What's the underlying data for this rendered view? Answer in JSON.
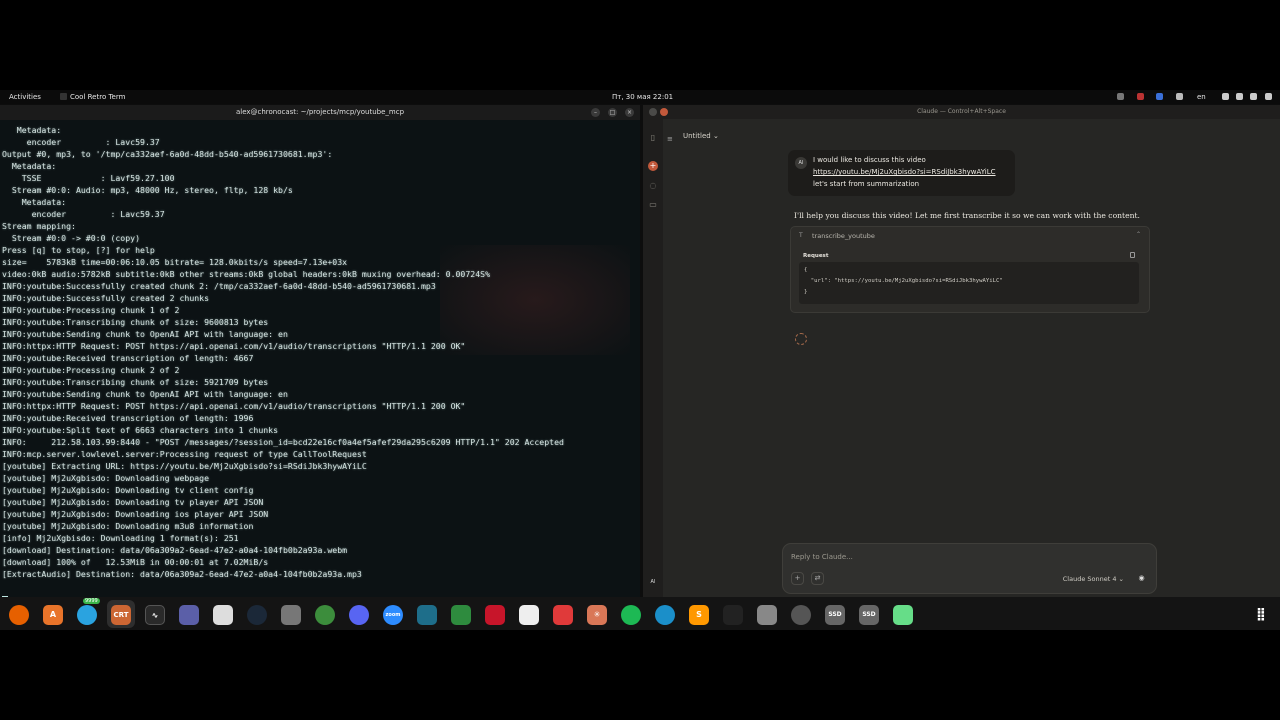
{
  "topbar": {
    "activities": "Activities",
    "app_name": "Cool Retro Term",
    "datetime": "Пт, 30 мая  22:01",
    "lang": "en"
  },
  "terminal": {
    "title": "alex@chronocast: ~/projects/mcp/youtube_mcp",
    "lines": [
      "   Metadata:",
      "     encoder         : Lavc59.37",
      "Output #0, mp3, to '/tmp/ca332aef-6a0d-48dd-b540-ad5961730681.mp3':",
      "  Metadata:",
      "    TSSE            : Lavf59.27.100",
      "  Stream #0:0: Audio: mp3, 48000 Hz, stereo, fltp, 128 kb/s",
      "    Metadata:",
      "      encoder         : Lavc59.37",
      "Stream mapping:",
      "  Stream #0:0 -> #0:0 (copy)",
      "Press [q] to stop, [?] for help",
      "size=    5783kB time=00:06:10.05 bitrate= 128.0kbits/s speed=7.13e+03x",
      "video:0kB audio:5782kB subtitle:0kB other streams:0kB global headers:0kB muxing overhead: 0.00724S%",
      "INFO:youtube:Successfully created chunk 2: /tmp/ca332aef-6a0d-48dd-b540-ad5961730681.mp3",
      "INFO:youtube:Successfully created 2 chunks",
      "INFO:youtube:Processing chunk 1 of 2",
      "INFO:youtube:Transcribing chunk of size: 9600813 bytes",
      "INFO:youtube:Sending chunk to OpenAI API with language: en",
      "INFO:httpx:HTTP Request: POST https://api.openai.com/v1/audio/transcriptions \"HTTP/1.1 200 OK\"",
      "INFO:youtube:Received transcription of length: 4667",
      "INFO:youtube:Processing chunk 2 of 2",
      "INFO:youtube:Transcribing chunk of size: 5921709 bytes",
      "INFO:youtube:Sending chunk to OpenAI API with language: en",
      "INFO:httpx:HTTP Request: POST https://api.openai.com/v1/audio/transcriptions \"HTTP/1.1 200 OK\"",
      "INFO:youtube:Received transcription of length: 1996",
      "INFO:youtube:Split text of 6663 characters into 1 chunks",
      "INFO:     212.58.103.99:8440 - \"POST /messages/?session_id=bcd22e16cf0a4ef5afef29da295c6209 HTTP/1.1\" 202 Accepted",
      "INFO:mcp.server.lowlevel.server:Processing request of type CallToolRequest",
      "[youtube] Extracting URL: https://youtu.be/Mj2uXgbisdo?si=RSdiJbk3hywAYiLC",
      "[youtube] Mj2uXgbisdo: Downloading webpage",
      "[youtube] Mj2uXgbisdo: Downloading tv client config",
      "[youtube] Mj2uXgbisdo: Downloading tv player API JSON",
      "[youtube] Mj2uXgbisdo: Downloading ios player API JSON",
      "[youtube] Mj2uXgbisdo: Downloading m3u8 information",
      "[info] Mj2uXgbisdo: Downloading 1 format(s): 251",
      "[download] Destination: data/06a309a2-6ead-47e2-a0a4-104fb0b2a93a.webm",
      "[download] 100% of   12.53MiB in 00:00:01 at 7.02MiB/s",
      "[ExtractAudio] Destination: data/06a309a2-6ead-47e2-a0a4-104fb0b2a93a.mp3"
    ]
  },
  "claude": {
    "window_title": "Claude — Control+Alt+Space",
    "conversation_title": "Untitled",
    "user_avatar": "AI",
    "user_message": {
      "line1": "I would like to discuss this video",
      "link": "https://youtu.be/Mj2uXgbisdo?si=RSdiJbk3hywAYiLC",
      "line3": "let's start from summarization"
    },
    "assistant_text": "I'll help you discuss this video! Let me first transcribe it so we can work with the content.",
    "tool": {
      "name": "transcribe_youtube",
      "request_label": "Request",
      "code": "{\n  \"url\": \"https://youtu.be/Mj2uXgbisdo?si=RSdiJbk3hywAYiLC\"\n}"
    },
    "reply_placeholder": "Reply to Claude...",
    "model": "Claude Sonnet 4",
    "side_avatar": "AI"
  },
  "dock": {
    "badge": "9999",
    "items": [
      "firefox-icon",
      "app-store-icon",
      "telegram-icon",
      "cool-retro-term-icon",
      "system-monitor-icon",
      "screenshot-icon",
      "terminal-icon",
      "steam-icon",
      "gimp-icon",
      "chrome-icon",
      "discord-icon",
      "zoom-icon",
      "files-app-icon",
      "spreadsheet-icon",
      "pdf-reader-icon",
      "inkscape-icon",
      "todo-icon",
      "claude-icon",
      "spotify-icon",
      "proxy-icon",
      "sublime-icon",
      "tool-icon",
      "folder-icon",
      "disk-icon",
      "ssd-icon-1",
      "ssd-icon-2",
      "trash-icon",
      "app-grid-icon"
    ]
  }
}
